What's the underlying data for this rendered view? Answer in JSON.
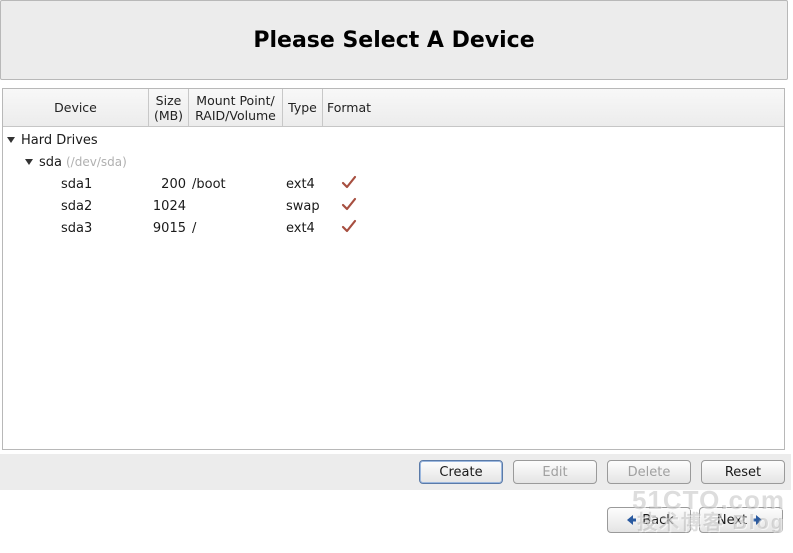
{
  "title": "Please Select A Device",
  "columns": {
    "device": "Device",
    "size": "Size\n(MB)",
    "mount": "Mount Point/\nRAID/Volume",
    "type": "Type",
    "format": "Format"
  },
  "tree": {
    "root_label": "Hard Drives",
    "disk": {
      "name": "sda",
      "devpath": "(/dev/sda)"
    },
    "partitions": [
      {
        "name": "sda1",
        "size_mb": "200",
        "mount": "/boot",
        "type": "ext4",
        "format": true
      },
      {
        "name": "sda2",
        "size_mb": "1024",
        "mount": "",
        "type": "swap",
        "format": true
      },
      {
        "name": "sda3",
        "size_mb": "9015",
        "mount": "/",
        "type": "ext4",
        "format": true
      }
    ]
  },
  "buttons": {
    "create": "Create",
    "edit": "Edit",
    "delete": "Delete",
    "reset": "Reset",
    "back": "Back",
    "next": "Next"
  },
  "watermark": {
    "line1": "51CTO.com",
    "line2": "技术博客  Blog"
  }
}
